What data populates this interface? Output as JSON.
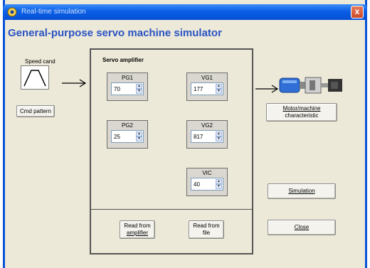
{
  "window": {
    "title": "Real-time simulation",
    "close_glyph": "x"
  },
  "heading": "General-purpose servo machine simulator",
  "speed": {
    "label": "Speed cand",
    "button": "Cmd pattern"
  },
  "amplifier": {
    "title": "Servo amplifier",
    "params": [
      {
        "name": "PG1",
        "value": "70"
      },
      {
        "name": "VG1",
        "value": "177"
      },
      {
        "name": "PG2",
        "value": "25"
      },
      {
        "name": "VG2",
        "value": "817"
      },
      {
        "name": "VIC",
        "value": "40"
      }
    ],
    "read_amp_line1": "Read from",
    "read_amp_line2": "amplifier",
    "read_file_line1": "Read from",
    "read_file_line2": "file"
  },
  "motor": {
    "button_line1": "Motor/machine",
    "button_line2": "characteristic"
  },
  "actions": {
    "simulation": "Simulation",
    "close": "Close"
  },
  "icons": {
    "app": "app-icon",
    "close": "close-icon",
    "trapezoid": "trapezoid-speed-icon",
    "motor": "servo-motor-icon"
  },
  "colors": {
    "titlebar": "#0a5fe6",
    "heading": "#2b53c4",
    "face": "#ece9d8"
  }
}
